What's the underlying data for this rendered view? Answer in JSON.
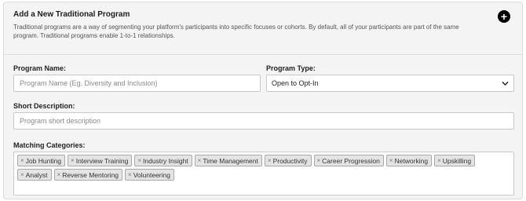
{
  "header": {
    "title": "Add a New Traditional Program",
    "description": "Traditional programs are a way of segmenting your platform's participants into specific focuses or cohorts. By default, all of your participants are part of the same program. Traditional programs enable 1-to-1 relationships.",
    "add_icon": "plus-circle-icon"
  },
  "form": {
    "program_name": {
      "label": "Program Name:",
      "placeholder": "Program Name (Eg. Diversity and Inclusion)",
      "value": ""
    },
    "program_type": {
      "label": "Program Type:",
      "selected": "Open to Opt-In",
      "icon": "chevron-down-icon"
    },
    "short_description": {
      "label": "Short Description:",
      "placeholder": "Program short description",
      "value": ""
    },
    "matching_categories": {
      "label": "Matching Categories:",
      "remove_glyph": "×",
      "tags": [
        "Job Hunting",
        "Interview Training",
        "Industry Insight",
        "Time Management",
        "Productivity",
        "Career Progression",
        "Networking",
        "Upskilling",
        "Analyst",
        "Reverse Mentoring",
        "Volunteering"
      ]
    }
  }
}
